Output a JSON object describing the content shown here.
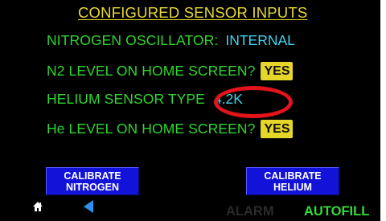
{
  "screen": {
    "title": "CONFIGURED SENSOR INPUTS",
    "nitrogen_oscillator": {
      "label": "NITROGEN OSCILLATOR:",
      "value": "INTERNAL"
    },
    "n2_level_home": {
      "label": "N2 LEVEL ON HOME SCREEN?",
      "value": "YES"
    },
    "helium_sensor_type": {
      "label": "HELIUM SENSOR TYPE",
      "value": "4.2K"
    },
    "he_level_home": {
      "label": "He LEVEL ON HOME SCREEN?",
      "value": "YES"
    },
    "calibrate_nitrogen": {
      "line1": "CALIBRATE",
      "line2": "NITROGEN"
    },
    "calibrate_helium": {
      "line1": "CALIBRATE",
      "line2": "HELIUM"
    }
  },
  "footer": {
    "alarm": "ALARM",
    "autofill": "AUTOFILL"
  },
  "icons": {
    "home": "home-icon",
    "back": "back-arrow-icon"
  },
  "colors": {
    "title": "#e8d832",
    "label": "#2fd62f",
    "value": "#3fd6f0",
    "yes_badge": "#e6d62a",
    "button": "#1212d8",
    "highlight_ring": "#e2131a",
    "autofill": "#33d93a",
    "alarm_inactive": "#2a2a2a"
  }
}
